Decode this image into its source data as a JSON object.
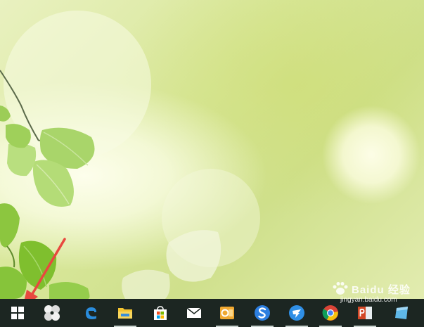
{
  "desktop": {
    "wallpaper": "green-leaves-bokeh"
  },
  "taskbar": {
    "background": "#1c2622",
    "items": [
      {
        "name": "start-button",
        "icon": "windows-logo-icon",
        "running": false
      },
      {
        "name": "taskview-button",
        "icon": "pinwheel-icon",
        "running": false
      },
      {
        "name": "edge-button",
        "icon": "edge-icon",
        "running": false
      },
      {
        "name": "file-explorer-button",
        "icon": "folder-icon",
        "running": true
      },
      {
        "name": "store-button",
        "icon": "store-icon",
        "running": false
      },
      {
        "name": "mail-button",
        "icon": "mail-icon",
        "running": false
      },
      {
        "name": "outlook-button",
        "icon": "outlook-icon",
        "running": true
      },
      {
        "name": "sogou-browser-button",
        "icon": "s-browser-icon",
        "running": true
      },
      {
        "name": "dingtalk-button",
        "icon": "bird-icon",
        "running": true
      },
      {
        "name": "chrome-button",
        "icon": "chrome-icon",
        "running": true
      },
      {
        "name": "powerpoint-button",
        "icon": "powerpoint-icon",
        "running": true
      },
      {
        "name": "windows-app-button",
        "icon": "blue-window-icon",
        "running": false
      }
    ]
  },
  "annotation": {
    "arrow_color": "#e8493f"
  },
  "watermark": {
    "brand": "Baidu 经验",
    "url": "jingyan.baidu.com"
  }
}
